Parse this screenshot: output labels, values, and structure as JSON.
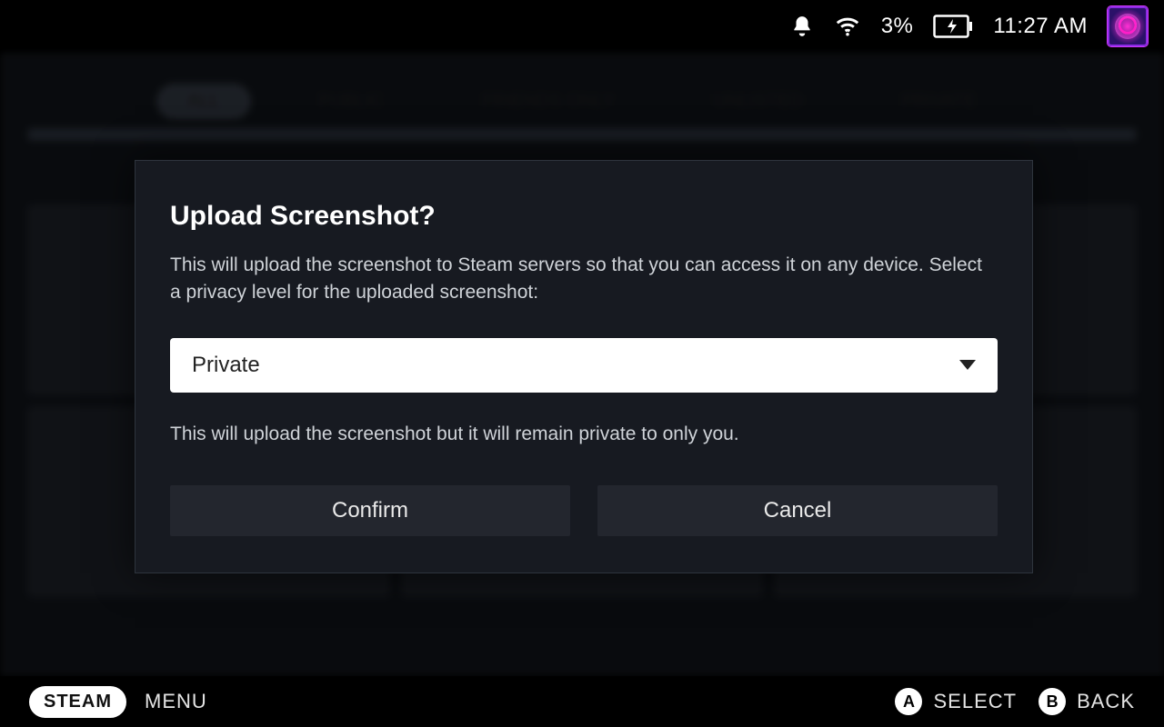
{
  "statusbar": {
    "battery_pct": "3%",
    "clock": "11:27 AM"
  },
  "background_tabs": [
    "ALL",
    "PUBLIC",
    "FRIENDS ONLY",
    "UNLISTED",
    "PRIVATE"
  ],
  "modal": {
    "title": "Upload Screenshot?",
    "description": "This will upload the screenshot to Steam servers so that you can access it on any device. Select a privacy level for the uploaded screenshot:",
    "select": {
      "value": "Private"
    },
    "hint": "This will upload the screenshot but it will remain private to only you.",
    "confirm_label": "Confirm",
    "cancel_label": "Cancel"
  },
  "footer": {
    "steam_label": "STEAM",
    "menu_label": "MENU",
    "a_glyph": "A",
    "a_label": "SELECT",
    "b_glyph": "B",
    "b_label": "BACK"
  }
}
